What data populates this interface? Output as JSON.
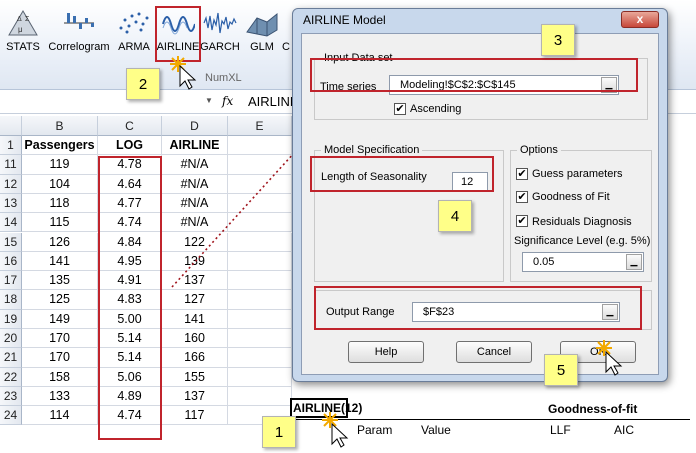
{
  "ribbon": {
    "buttons": [
      {
        "label": "STATS",
        "icon": "stats-icon"
      },
      {
        "label": "Correlogram",
        "icon": "correlogram-icon"
      },
      {
        "label": "ARMA",
        "icon": "arma-icon"
      },
      {
        "label": "AIRLINE",
        "icon": "airline-icon"
      },
      {
        "label": "GARCH",
        "icon": "garch-icon"
      },
      {
        "label": "GLM",
        "icon": "glm-icon"
      },
      {
        "label": "C",
        "icon": "more-icon"
      }
    ],
    "stats_symbol": "Δ Σ μ σ",
    "group_label": "NumXL"
  },
  "formula_bar": {
    "fx": "fx",
    "text": "AIRLINE"
  },
  "sheet": {
    "columns": [
      "B",
      "C",
      "D",
      "E"
    ],
    "header_row": {
      "num": "1",
      "cells": [
        "Passengers",
        "LOG",
        "AIRLINE",
        ""
      ]
    },
    "rows": [
      {
        "num": "11",
        "cells": [
          "119",
          "4.78",
          "#N/A",
          ""
        ]
      },
      {
        "num": "12",
        "cells": [
          "104",
          "4.64",
          "#N/A",
          ""
        ]
      },
      {
        "num": "13",
        "cells": [
          "118",
          "4.77",
          "#N/A",
          ""
        ]
      },
      {
        "num": "14",
        "cells": [
          "115",
          "4.74",
          "#N/A",
          ""
        ]
      },
      {
        "num": "15",
        "cells": [
          "126",
          "4.84",
          "122",
          ""
        ]
      },
      {
        "num": "16",
        "cells": [
          "141",
          "4.95",
          "139",
          ""
        ]
      },
      {
        "num": "17",
        "cells": [
          "135",
          "4.91",
          "137",
          ""
        ]
      },
      {
        "num": "18",
        "cells": [
          "125",
          "4.83",
          "127",
          ""
        ]
      },
      {
        "num": "19",
        "cells": [
          "149",
          "5.00",
          "141",
          ""
        ]
      },
      {
        "num": "20",
        "cells": [
          "170",
          "5.14",
          "160",
          ""
        ]
      },
      {
        "num": "21",
        "cells": [
          "170",
          "5.14",
          "166",
          ""
        ]
      },
      {
        "num": "22",
        "cells": [
          "158",
          "5.06",
          "155",
          ""
        ]
      },
      {
        "num": "23",
        "cells": [
          "133",
          "4.89",
          "137",
          ""
        ]
      },
      {
        "num": "24",
        "cells": [
          "114",
          "4.74",
          "117",
          ""
        ]
      }
    ],
    "output_block": {
      "title": "AIRLINE(12)",
      "param": "Param",
      "value": "Value",
      "goodness": "Goodness-of-fit",
      "llf": "LLF",
      "aic": "AIC"
    }
  },
  "dialog": {
    "title": "AIRLINE Model",
    "close": "x",
    "input_group": "Input Data set",
    "time_series_label": "Time series",
    "time_series_value": "Modeling!$C$2:$C$145",
    "ascending_label": "Ascending",
    "ascending_checked": true,
    "model_group": "Model Specification",
    "seasonality_label": "Length of Seasonality",
    "seasonality_value": "12",
    "options_group": "Options",
    "guess_label": "Guess parameters",
    "gof_label": "Goodness of Fit",
    "resid_label": "Residuals Diagnosis",
    "significance_label": "Significance Level (e.g. 5%)",
    "significance_value": "0.05",
    "output_label": "Output Range",
    "output_value": "$F$23",
    "help_btn": "Help",
    "cancel_btn": "Cancel",
    "ok_btn": "OK",
    "checkmark": "✔",
    "picker_glyph": "▁"
  },
  "callouts": [
    "1",
    "2",
    "3",
    "4",
    "5"
  ],
  "colors": {
    "highlight": "#c0242c",
    "note": "#ffff88",
    "dialog_frame": "#c8d8ec"
  }
}
